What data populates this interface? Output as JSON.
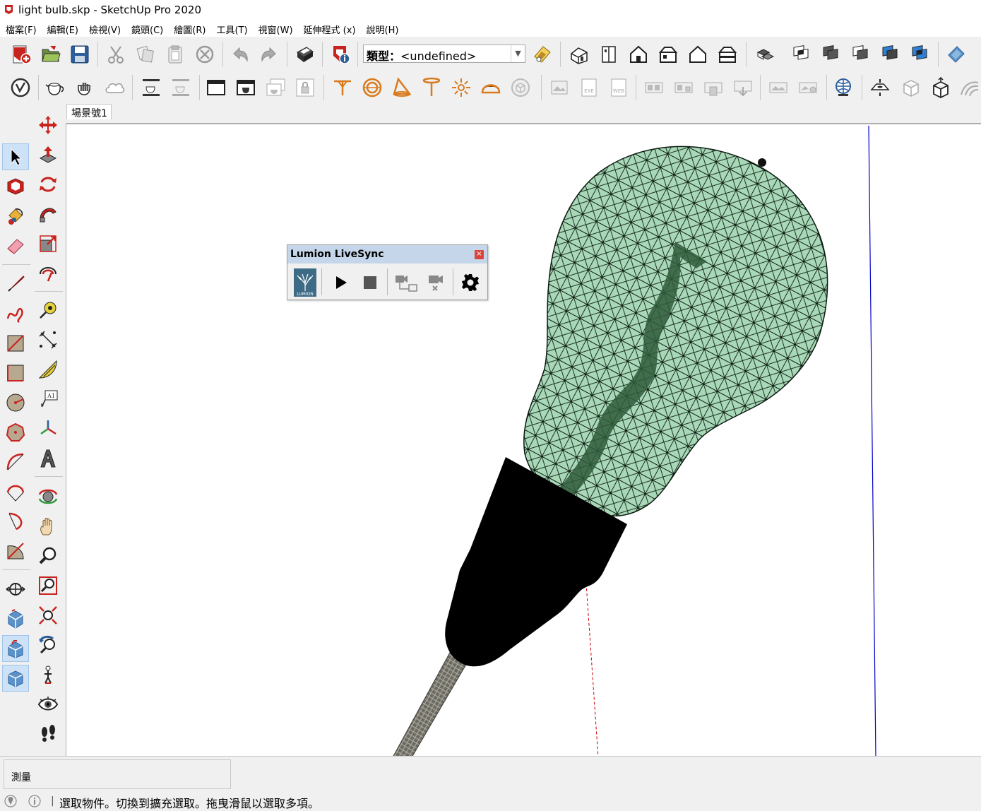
{
  "window": {
    "title": "light bulb.skp - SketchUp Pro 2020"
  },
  "menu": [
    "檔案(F)",
    "編輯(E)",
    "檢視(V)",
    "鏡頭(C)",
    "繪圖(R)",
    "工具(T)",
    "視窗(W)",
    "延伸程式 (x)",
    "說明(H)"
  ],
  "toolbar": {
    "styles_label": "類型：",
    "styles_value": "<undefined>"
  },
  "scene_tab": "場景號1",
  "livesync": {
    "title": "Lumion LiveSync",
    "close_glyph": "×",
    "logo_text": "LUMION"
  },
  "left_toolbar": {
    "text_tool_glyph": "A1"
  },
  "status": {
    "measure_label": "測量",
    "hint": "選取物件。切換到擴充選取。拖曳滑鼠以選取多項。",
    "divider": "|"
  },
  "colors": {
    "accent_orange": "#d97a1c",
    "red_icon": "#c8231e",
    "blue_axis": "#0000c8",
    "red_axis": "#c80000",
    "bulb_glass": "#9fd4b0",
    "livesync_title": "#c6d6ea"
  }
}
